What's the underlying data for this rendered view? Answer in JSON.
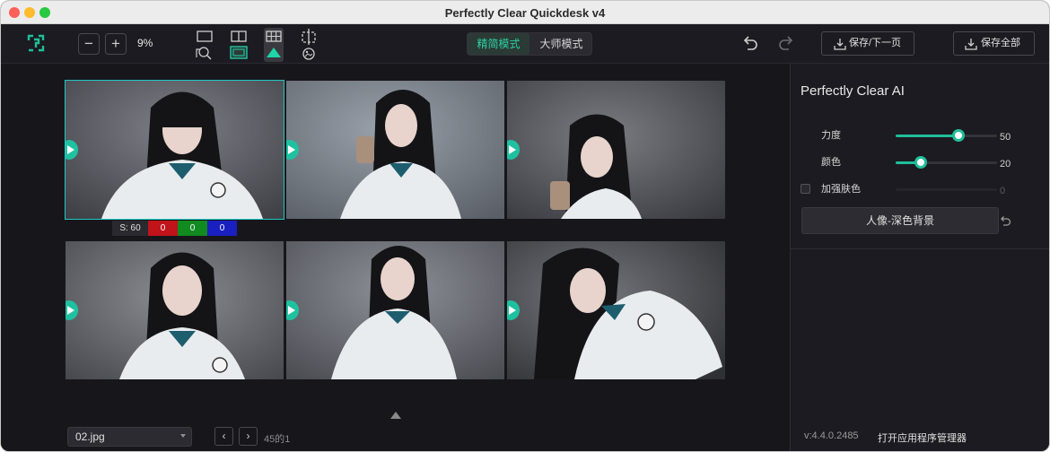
{
  "window": {
    "title": "Perfectly Clear Quickdesk v4"
  },
  "toolbar": {
    "zoom_out": "−",
    "zoom_in": "+",
    "zoom_value": "9%",
    "modes": [
      "精简模式",
      "大师模式"
    ],
    "active_mode": "精简模式",
    "save_next_label": "保存/下一页",
    "save_all_label": "保存全部",
    "icons": [
      "logo-icon",
      "single-view-icon",
      "compare-view-icon",
      "grid-view-icon",
      "crop-icon",
      "undo-icon",
      "redo-icon",
      "download-icon"
    ]
  },
  "grid": {
    "selected_index": 0,
    "photo_count": 6
  },
  "stats": {
    "s": "S: 60",
    "r": "0",
    "g": "0",
    "b": "0"
  },
  "footer": {
    "file_name": "02.jpg",
    "prev": "‹",
    "next": "›",
    "page_info": "45的1"
  },
  "panel": {
    "title": "Perfectly Clear AI",
    "sliders": [
      {
        "label": "力度",
        "value": "50",
        "fraction": 0.62
      },
      {
        "label": "颜色",
        "value": "20",
        "fraction": 0.25
      },
      {
        "label": "加强肤色",
        "value": "0",
        "fraction": 0
      }
    ],
    "preset_label": "人像-深色背景",
    "version": "v:4.4.0.2485",
    "open_manager": "打开应用程序管理器"
  },
  "colors": {
    "accent": "#1fbf9a",
    "selection": "#1fc9c5",
    "background": "#17161b"
  }
}
